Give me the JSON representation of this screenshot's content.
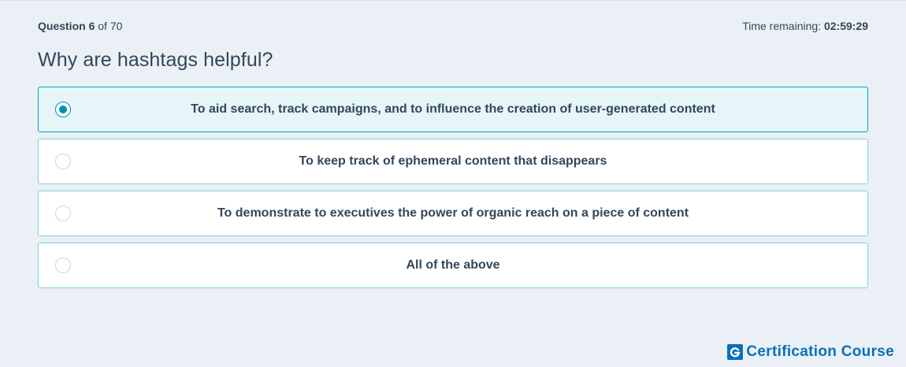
{
  "header": {
    "question_word": "Question",
    "question_number": "6",
    "question_of": "of 70",
    "time_label": "Time remaining:",
    "time_value": "02:59:29"
  },
  "question": {
    "title": "Why are hashtags helpful?"
  },
  "answers": [
    {
      "label": "To aid search, track campaigns, and to influence the creation of user-generated content",
      "selected": true
    },
    {
      "label": "To keep track of ephemeral content that disappears",
      "selected": false
    },
    {
      "label": "To demonstrate to executives the power of organic reach on a piece of content",
      "selected": false
    },
    {
      "label": "All of the above",
      "selected": false
    }
  ],
  "brand": {
    "text": "Certification Course",
    "icon": "g-logo-icon",
    "color": "#0a6fb8"
  },
  "colors": {
    "accent": "#0091ae",
    "selected_bg": "#e5f5f8",
    "border": "#7fd1de",
    "page_bg": "#eaf0f6"
  }
}
